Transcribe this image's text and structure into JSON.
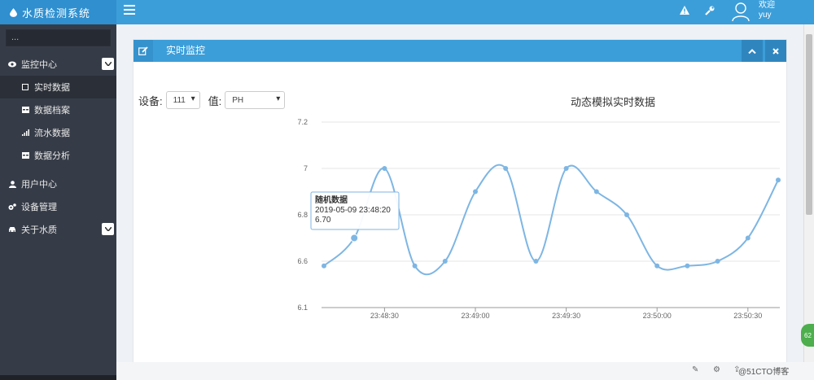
{
  "app": {
    "title": "水质检测系统"
  },
  "topbar": {
    "user_line1": "欢迎",
    "user_line2": "yuy"
  },
  "sidebar": {
    "search_text": "...",
    "items": [
      {
        "label": "监控中心",
        "icon": "eye-icon"
      },
      {
        "label": "实时数据",
        "icon": "square-icon"
      },
      {
        "label": "数据档案",
        "icon": "table-icon"
      },
      {
        "label": "流水数据",
        "icon": "signal-icon"
      },
      {
        "label": "数据分析",
        "icon": "table-icon"
      },
      {
        "label": "用户中心",
        "icon": "user-icon"
      },
      {
        "label": "设备管理",
        "icon": "cogs-icon"
      },
      {
        "label": "关于水质",
        "icon": "car-icon"
      }
    ]
  },
  "panel": {
    "title": "实时监控",
    "device_label": "设备:",
    "device_value": "111",
    "value_label": "值:",
    "value_value": "PH"
  },
  "tooltip": {
    "series": "随机数据",
    "time": "2019-05-09 23:48:20",
    "value": "6.70"
  },
  "bottombar": {
    "text": "@51CTO博客"
  },
  "badge": {
    "text": "62"
  },
  "colors": {
    "primary": "#3c9ed9",
    "sidebar": "#363c47",
    "line": "#7eb6e3"
  },
  "chart_data": {
    "type": "line",
    "title": "动态模拟实时数据",
    "xlabel": "",
    "ylabel": "",
    "ylim": [
      6.1,
      7.2
    ],
    "yticks": [
      "7.2",
      "7",
      "6.8",
      "6.6",
      "6.1"
    ],
    "xticks": [
      "23:48:30",
      "23:49:00",
      "23:49:30",
      "23:50:00",
      "23:50:30"
    ],
    "grid": true,
    "series": [
      {
        "name": "随机数据",
        "x": [
          "23:48:10",
          "23:48:20",
          "23:48:30",
          "23:48:40",
          "23:48:50",
          "23:49:00",
          "23:49:10",
          "23:49:20",
          "23:49:30",
          "23:49:40",
          "23:49:50",
          "23:50:00",
          "23:50:10",
          "23:50:20",
          "23:50:30",
          "23:50:40"
        ],
        "values": [
          6.5,
          6.7,
          7.0,
          6.5,
          6.6,
          6.9,
          7.0,
          6.6,
          7.0,
          6.9,
          6.8,
          6.5,
          6.5,
          6.6,
          6.7,
          6.95
        ]
      }
    ]
  }
}
